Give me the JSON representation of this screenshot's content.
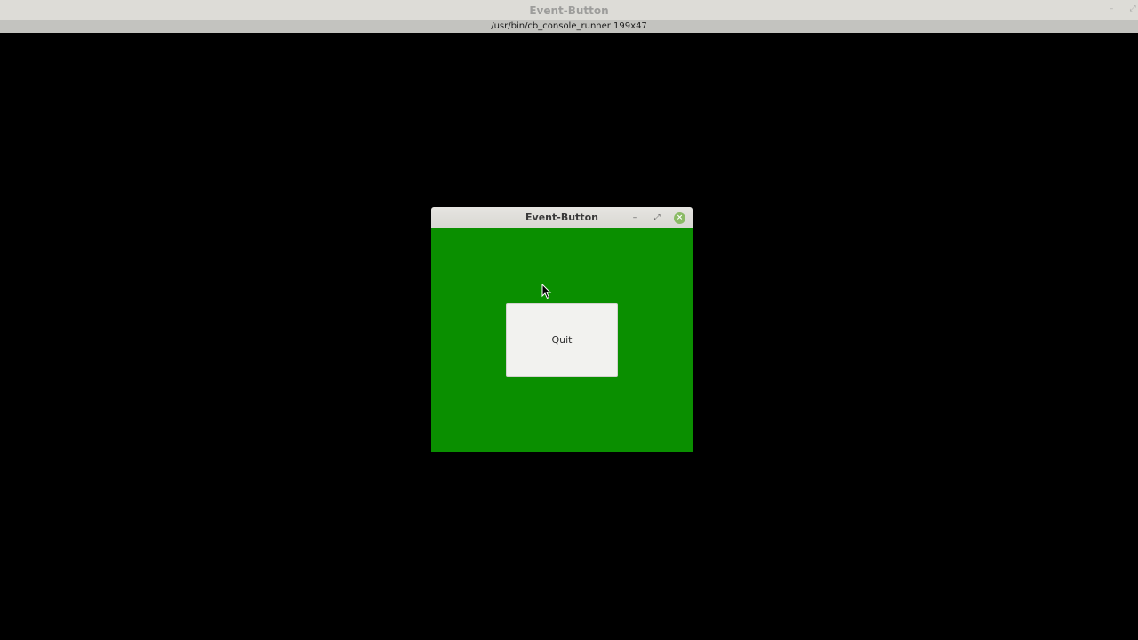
{
  "terminal": {
    "title": "Event-Button",
    "info": "/usr/bin/cb_console_runner 199x47",
    "minimize_glyph": "–",
    "maximize_glyph": "⤢"
  },
  "app_window": {
    "title": "Event-Button",
    "minimize_glyph": "–",
    "maximize_glyph": "⤢",
    "close_glyph": "×",
    "quit_label": "Quit",
    "colors": {
      "body_background": "#0a8f00",
      "close_button": "#8bbb66",
      "button_background": "#f2f2ef"
    }
  },
  "desktop": {
    "background": "#000000"
  }
}
